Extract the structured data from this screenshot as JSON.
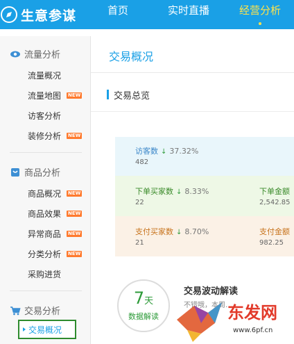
{
  "app": {
    "name": "生意参谋"
  },
  "nav": [
    {
      "label": "首页"
    },
    {
      "label": "实时直播"
    },
    {
      "label": "经营分析",
      "active": true
    }
  ],
  "sidebar": {
    "groups": [
      {
        "title": "流量分析",
        "icon": "eye-icon",
        "items": [
          {
            "label": "流量概况",
            "new": false
          },
          {
            "label": "流量地图",
            "new": true
          },
          {
            "label": "访客分析",
            "new": false
          },
          {
            "label": "装修分析",
            "new": true
          }
        ]
      },
      {
        "title": "商品分析",
        "icon": "bag-icon",
        "items": [
          {
            "label": "商品概况",
            "new": true
          },
          {
            "label": "商品效果",
            "new": true
          },
          {
            "label": "异常商品",
            "new": true
          },
          {
            "label": "分类分析",
            "new": true
          },
          {
            "label": "采购进货",
            "new": false
          }
        ]
      },
      {
        "title": "交易分析",
        "icon": "cart-icon",
        "items": [
          {
            "label": "交易概况",
            "active": true
          }
        ]
      }
    ],
    "new_badge": "NEW"
  },
  "main": {
    "page_title": "交易概况",
    "section_title": "交易总览",
    "metrics": [
      {
        "label": "访客数",
        "change": "37.32%",
        "value": "482"
      },
      {
        "label": "下单买家数",
        "change": "8.33%",
        "value": "22"
      },
      {
        "label": "下单金额",
        "value": "2,542.85"
      },
      {
        "label": "支付买家数",
        "change": "8.70%",
        "value": "21"
      },
      {
        "label": "支付金额",
        "value": "982.25"
      }
    ],
    "interpretation": {
      "days": "7",
      "days_unit": "天",
      "caption": "数据解读",
      "title": "交易波动解读",
      "text": "不错哦，本周…"
    }
  },
  "watermark": {
    "text": "东发网",
    "url": "www.6pf.cn"
  },
  "colors": {
    "brand": "#1aa0e6",
    "active_nav": "#ffe24a",
    "new_badge": "#ff7a2e",
    "down_arrow": "#2e9b3a"
  }
}
